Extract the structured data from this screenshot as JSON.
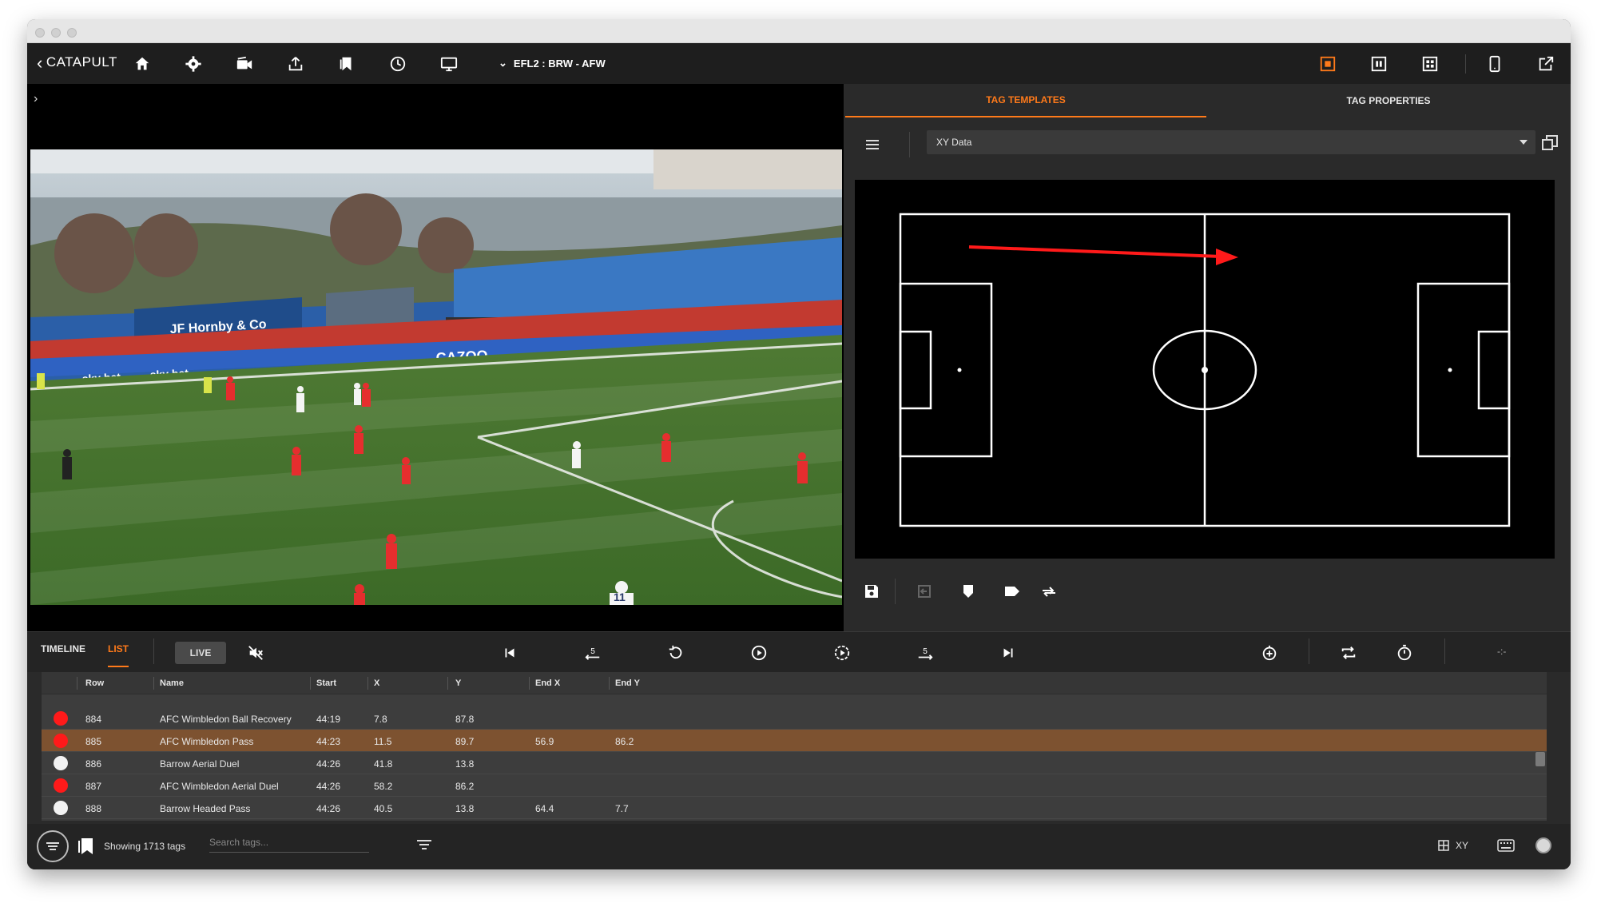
{
  "app": {
    "name": "CATAPULT",
    "match_title": "EFL2 : BRW - AFW"
  },
  "colors": {
    "accent": "#ff7a1a",
    "team_red": "#ff1a1a",
    "team_white": "#f2f2f2",
    "selected_row": "#7d5230"
  },
  "toolbar": {
    "icons": [
      "home-icon",
      "settings-icon",
      "camera-icon",
      "share-icon",
      "bookmark-icon",
      "clock-icon",
      "monitor-icon"
    ],
    "right_icons": [
      "layout-single-icon",
      "layout-split-icon",
      "layout-grid-icon",
      "tablet-icon",
      "external-link-icon"
    ]
  },
  "right_panel": {
    "tabs": [
      {
        "label": "TAG TEMPLATES",
        "active": true
      },
      {
        "label": "TAG PROPERTIES",
        "active": false
      }
    ],
    "template_select": "XY Data"
  },
  "bottom": {
    "mode_tabs": [
      {
        "label": "TIMELINE",
        "active": false
      },
      {
        "label": "LIST",
        "active": true
      }
    ],
    "live_label": "LIVE",
    "ctrl_icons": [
      "mute-icon",
      "skip-start-icon",
      "rewind-5-icon",
      "replay-icon",
      "play-icon",
      "play-step-icon",
      "forward-5-icon",
      "skip-end-icon"
    ],
    "right_ctrl_icons": [
      "add-tag-icon",
      "loop-icon",
      "timer-icon"
    ],
    "right_ctrl_text": "-:-"
  },
  "table": {
    "columns": [
      "Row",
      "Name",
      "Start",
      "X",
      "Y",
      "End X",
      "End Y"
    ],
    "rows": [
      {
        "team": "red",
        "row": "884",
        "name": "AFC Wimbledon Ball Recovery",
        "start": "44:19",
        "x": "7.8",
        "y": "87.8",
        "end_x": "",
        "end_y": "",
        "selected": false
      },
      {
        "team": "red",
        "row": "885",
        "name": "AFC Wimbledon Pass",
        "start": "44:23",
        "x": "11.5",
        "y": "89.7",
        "end_x": "56.9",
        "end_y": "86.2",
        "selected": true
      },
      {
        "team": "white",
        "row": "886",
        "name": "Barrow Aerial Duel",
        "start": "44:26",
        "x": "41.8",
        "y": "13.8",
        "end_x": "",
        "end_y": "",
        "selected": false
      },
      {
        "team": "red",
        "row": "887",
        "name": "AFC Wimbledon Aerial Duel",
        "start": "44:26",
        "x": "58.2",
        "y": "86.2",
        "end_x": "",
        "end_y": "",
        "selected": false
      },
      {
        "team": "white",
        "row": "888",
        "name": "Barrow Headed Pass",
        "start": "44:26",
        "x": "40.5",
        "y": "13.8",
        "end_x": "64.4",
        "end_y": "7.7",
        "selected": false
      }
    ]
  },
  "status": {
    "tag_count": "Showing 1713 tags",
    "search_placeholder": "Search tags...",
    "xy_label": "XY"
  },
  "video": {
    "banners": [
      "JF Hornby & Co",
      "sky bet",
      "sky bet",
      "CAZOO"
    ],
    "player_number": "11"
  }
}
